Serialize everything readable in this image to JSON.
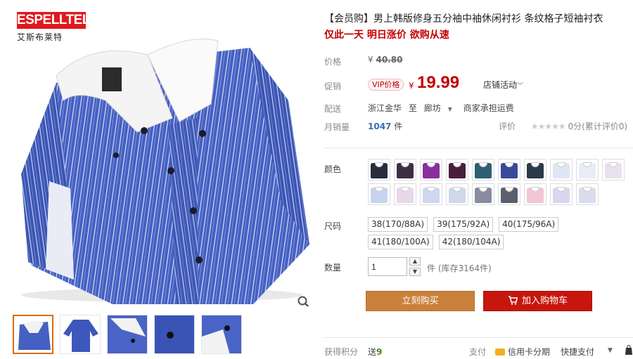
{
  "brand": {
    "logo_text": "ESPELLTEL",
    "sub_text": "艾斯布莱特"
  },
  "product": {
    "title": "【会员购】男上韩版修身五分袖中袖休闲衬衫 条纹格子短袖衬衣",
    "promo": "仅此一天 明日涨价 欲购从速"
  },
  "labels": {
    "price": "价格",
    "promo": "促销",
    "delivery": "配送",
    "monthly_sales": "月销量",
    "color": "颜色",
    "size": "尺码",
    "quantity": "数量",
    "points": "获得积分"
  },
  "price": {
    "currency": "¥",
    "original": "40.80",
    "vip_tag": "VIP价格",
    "current": "19.99",
    "shop_activity": "店铺活动"
  },
  "shipping": {
    "from": "浙江金华",
    "to_word": "至",
    "destination": "廊坊",
    "fee": "商家承担运费"
  },
  "sales": {
    "count": "1047",
    "unit": "件"
  },
  "rating": {
    "label": "评价",
    "stars": "★★★★★",
    "text": "0分(累计评价0)"
  },
  "colors": {
    "swatches": [
      "#2a2d3d",
      "#3c2f45",
      "#8a2fa0",
      "#4a1f3d",
      "#2f5f72",
      "#3a4a9a",
      "#2b3a48",
      "#dfe6f3",
      "#e8ecf6",
      "#e8e2ee",
      "#c8d4ee",
      "#e8d8e8",
      "#cfd6f0",
      "#cfd8ea",
      "#8a8aa0",
      "#5a5e6e",
      "#f0c6d6",
      "#dad6ee",
      "#d9dcec"
    ]
  },
  "sizes": [
    "38(170/88A)",
    "39(175/92A)",
    "40(175/96A)",
    "41(180/100A)",
    "42(180/104A)"
  ],
  "quantity": {
    "value": "1",
    "stock_text": "件 (库存3164件)"
  },
  "buttons": {
    "buy_now": "立刻购买",
    "add_cart": "加入购物车"
  },
  "footer": {
    "points_prefix": "送",
    "points_value": "9",
    "pay_label": "支付",
    "card_installment": "信用卡分期",
    "quick_pay": "快捷支付"
  }
}
